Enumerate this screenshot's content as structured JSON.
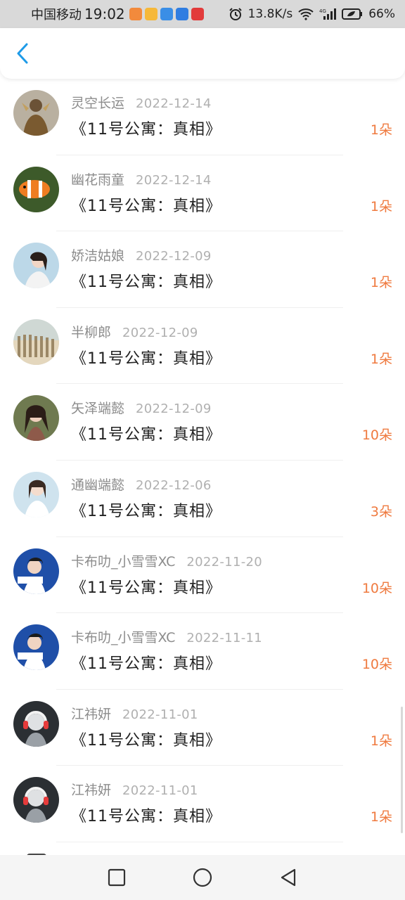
{
  "status_bar": {
    "carrier": "中国移动",
    "time": "19:02",
    "net_speed": "13.8K/s",
    "signal_label": "4G",
    "battery": "66%"
  },
  "colors": {
    "accent": "#1e9be8",
    "count": "#ef7a3f",
    "name": "#8c8c8c",
    "date": "#b0b0b0"
  },
  "records": [
    {
      "name": "灵空长运",
      "date": "2022-12-14",
      "title": "《11号公寓：真相》",
      "count": "1朵",
      "avatar": "warrior-avatar"
    },
    {
      "name": "幽花雨童",
      "date": "2022-12-14",
      "title": "《11号公寓：真相》",
      "count": "1朵",
      "avatar": "clownfish-avatar"
    },
    {
      "name": "娇洁姑娘",
      "date": "2022-12-09",
      "title": "《11号公寓：真相》",
      "count": "1朵",
      "avatar": "girl-avatar"
    },
    {
      "name": "半柳郎",
      "date": "2022-12-09",
      "title": "《11号公寓：真相》",
      "count": "1朵",
      "avatar": "fence-avatar"
    },
    {
      "name": "矢泽端懿",
      "date": "2022-12-09",
      "title": "《11号公寓：真相》",
      "count": "10朵",
      "avatar": "woman-avatar"
    },
    {
      "name": "通幽端懿",
      "date": "2022-12-06",
      "title": "《11号公寓：真相》",
      "count": "3朵",
      "avatar": "girl-white-avatar"
    },
    {
      "name": "卡布叻_小雪雪XC",
      "date": "2022-11-20",
      "title": "《11号公寓：真相》",
      "count": "10朵",
      "avatar": "boy-avatar"
    },
    {
      "name": "卡布叻_小雪雪XC",
      "date": "2022-11-11",
      "title": "《11号公寓：真相》",
      "count": "10朵",
      "avatar": "boy-avatar"
    },
    {
      "name": "江祎妍",
      "date": "2022-11-01",
      "title": "《11号公寓：真相》",
      "count": "1朵",
      "avatar": "headphone-avatar"
    },
    {
      "name": "江祎妍",
      "date": "2022-11-01",
      "title": "《11号公寓：真相》",
      "count": "1朵",
      "avatar": "headphone-avatar"
    }
  ],
  "nav": {
    "recent_icon": "square-icon",
    "home_icon": "circle-icon",
    "back_icon": "triangle-back-icon"
  }
}
